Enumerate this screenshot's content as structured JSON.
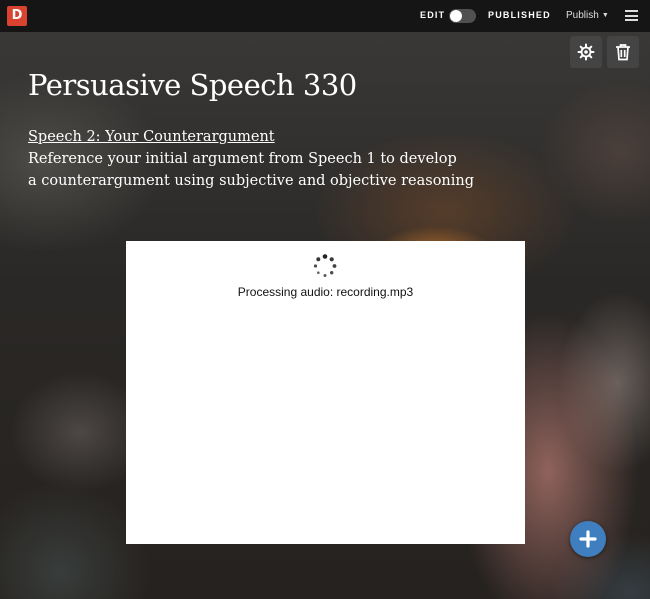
{
  "topbar": {
    "logo_letter": "D",
    "edit_label": "EDIT",
    "published_label": "PUBLISHED",
    "publish_menu_label": "Publish",
    "toggle_on": false
  },
  "actions": {
    "settings_icon": "gear-icon",
    "delete_icon": "trash-icon"
  },
  "content": {
    "title": "Persuasive Speech 330",
    "subtitle": "Speech 2: Your Counterargument",
    "description_lines": [
      "Reference your initial argument from Speech 1 to develop",
      "a counterargument using subjective and objective reasoning"
    ]
  },
  "media": {
    "status_text": "Processing audio: recording.mp3",
    "spinner_icon": "loading-spinner-icon"
  },
  "fab": {
    "icon": "plus-icon",
    "color": "#3f7fc0"
  },
  "colors": {
    "topbar": "#151515",
    "logo": "#d9432f"
  }
}
